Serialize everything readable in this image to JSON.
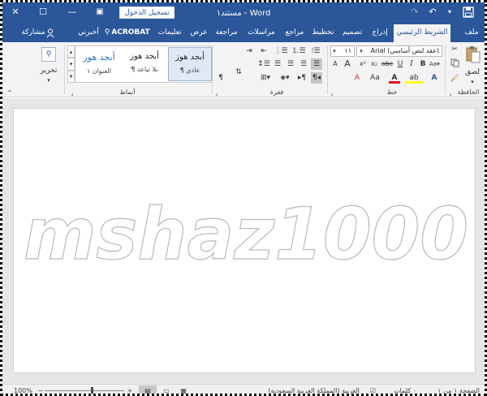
{
  "titlebar": {
    "document_title": "مستند١ - Word",
    "signin_label": "تسجيل الدخول",
    "close_glyph": "✕",
    "maximize_glyph": "☐",
    "minimize_glyph": "—",
    "ribbon_display_glyph": "▣",
    "undo_glyph": "↶",
    "redo_glyph": "↷",
    "save_icon": "save-icon"
  },
  "tabs": [
    {
      "label": "ملف"
    },
    {
      "label": "الشريط الرئيسي"
    },
    {
      "label": "إدراج"
    },
    {
      "label": "تصميم"
    },
    {
      "label": "تخطيط"
    },
    {
      "label": "مراجع"
    },
    {
      "label": "مراسلات"
    },
    {
      "label": "مراجعة"
    },
    {
      "label": "عرض"
    },
    {
      "label": "تعليمات"
    },
    {
      "label": "ACROBAT"
    },
    {
      "label": "أخبرني"
    },
    {
      "label": "مشاركة"
    }
  ],
  "ribbon": {
    "clipboard": {
      "label": "الحافظة",
      "paste_label": "لصق"
    },
    "font": {
      "label": "خط",
      "font_name": "Arial (عقد لنص أساسي)",
      "font_size": "١١",
      "grow": "A",
      "shrink": "A",
      "case": "Aa",
      "bold": "B",
      "italic": "I",
      "underline": "U",
      "strike": "abc",
      "subscript": "x₂",
      "superscript": "x²",
      "clear": "A",
      "text_effects": "A",
      "highlight": "ab",
      "font_color": "A"
    },
    "paragraph": {
      "label": "فقرة"
    },
    "styles": {
      "label": "أنماط",
      "items": [
        {
          "sample": "أبجد هوز",
          "name": "¶ عادي"
        },
        {
          "sample": "أبجد هوز",
          "name": "¶ بلا تباعد"
        },
        {
          "sample": "أبجد هوز",
          "name": "العنوان ١"
        }
      ]
    },
    "editing": {
      "label": "تحرير"
    }
  },
  "document": {
    "watermark_text": "mshaz1000"
  },
  "status": {
    "page": "الصفحة ١ من ١",
    "words": "٠ كلمات",
    "language": "العربية (المملكة العربية السعودية)",
    "zoom": "100%",
    "zoom_level": 1.0
  }
}
